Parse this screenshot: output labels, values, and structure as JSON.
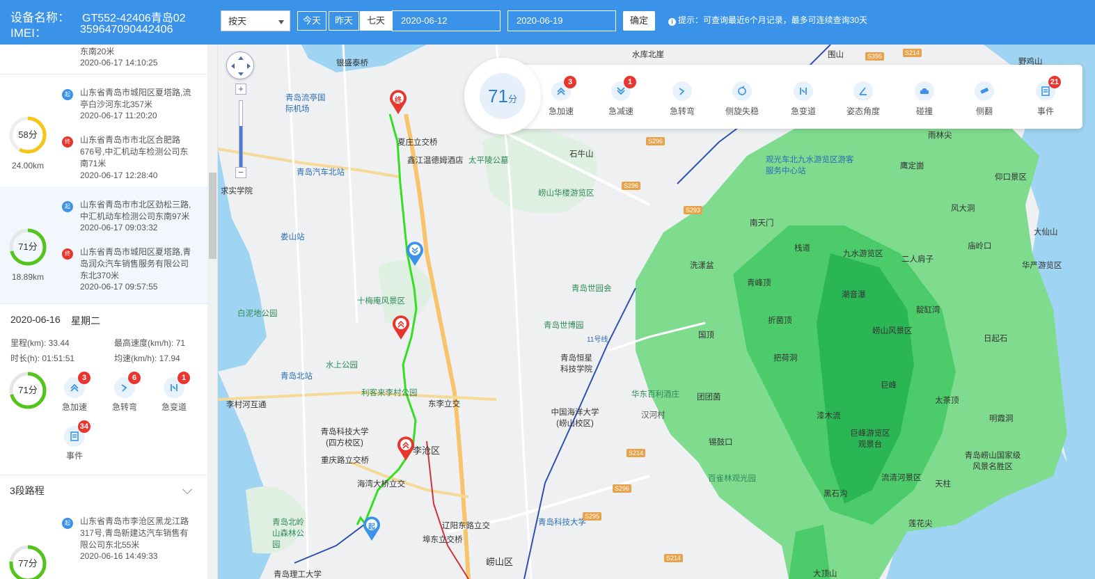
{
  "header": {
    "device_label": "设备名称：",
    "device_name": "GT552-42406青岛02",
    "imei_label": "IMEI：",
    "imei": "359647090442406",
    "mode_select": "按天",
    "btn_today": "今天",
    "btn_yesterday": "昨天",
    "btn_week": "七天",
    "date_start": "2020-06-12",
    "date_end": "2020-06-19",
    "btn_ok": "确定",
    "tip": "提示：可查询最近6个月记录，最多可连续查询30天"
  },
  "trips_top": [
    {
      "partial_addr": "东南20米",
      "partial_time": "2020-06-17 14:10:25"
    },
    {
      "score": "58分",
      "score_value": 58,
      "distance": "24.00km",
      "start_mark": "起",
      "start_addr": "山东省青岛市城阳区夏塔路,流亭白沙河东北357米",
      "start_time": "2020-06-17 11:20:20",
      "end_mark": "终",
      "end_addr": "山东省青岛市市北区合肥路676号,中汇机动车检测公司东南71米",
      "end_time": "2020-06-17 12:28:40"
    },
    {
      "score": "71分",
      "score_value": 71,
      "distance": "18.89km",
      "start_mark": "起",
      "start_addr": "山东省青岛市市北区劲松三路,中汇机动车检测公司东南97米",
      "start_time": "2020-06-17 09:03:32",
      "end_mark": "终",
      "end_addr": "山东省青岛市城阳区夏塔路,青岛润众汽车销售服务有限公司东北370米",
      "end_time": "2020-06-17 09:57:55"
    }
  ],
  "day_summary": {
    "date": "2020-06-16",
    "weekday": "星期二",
    "mileage": "里程(km): 33.44",
    "max_speed": "最高速度(km/h): 71",
    "duration": "时长(h): 01:51:51",
    "avg_speed": "均速(km/h): 17.94",
    "score": "71分",
    "score_value": 71,
    "events": [
      {
        "label": "急加速",
        "count": "3"
      },
      {
        "label": "急转弯",
        "count": "6"
      },
      {
        "label": "急变道",
        "count": "1"
      },
      {
        "label": "事件",
        "count": "34"
      }
    ]
  },
  "segments": {
    "title": "3段路程",
    "first": {
      "score": "77分",
      "score_value": 77,
      "start_mark": "起",
      "start_addr": "山东省青岛市李沧区黑龙江路317号,青岛新建达汽车销售有限公司东北55米",
      "start_time": "2020-06-16 14:49:33"
    }
  },
  "map": {
    "zoom_in": "+",
    "zoom_out": "−",
    "start_pin": "起",
    "end_pin": "终",
    "labels": {
      "l1": "银盛泰桥",
      "l2": "青岛流亭国际机场",
      "l3": "夏庄立交桥",
      "l4": "鑫江温德姆酒店",
      "l5": "太平陵公墓",
      "l6": "石牛山",
      "l7": "崂山华楼游览区",
      "l8": "青岛汽车北站",
      "l9": "娄山站",
      "l10": "十梅庵风景区",
      "l11": "白泥地公园",
      "l12": "青岛世园会",
      "l13": "青岛世博园",
      "l14": "水上公园",
      "l15": "青岛北站",
      "l16": "李村河互通",
      "l17": "利客来李村公园",
      "l18": "东李立交",
      "l19": "青岛科技大学(四方校区)",
      "l20": "重庆路立交桥",
      "l21": "海湾大桥立交",
      "l22": "青岛北岭山森林公园",
      "l23": "辽阳东路立交",
      "l24": "埠东立交桥",
      "l25": "崂山区",
      "l26": "青岛理工大学",
      "l27": "青岛恒星科技学院",
      "l28": "华东百利酒庄",
      "l29": "中国海洋大学(崂山校区)",
      "l30": "汉河村",
      "l31": "青岛科技大学",
      "l32": "水库北崖",
      "l33": "观光车北九水游览区游客服务中心站",
      "l34": "南天门",
      "l35": "洗漾盆",
      "l36": "青峰顶",
      "l37": "栈道",
      "l38": "九水游览区",
      "l39": "潮音瀑",
      "l40": "二人肩子",
      "l41": "靛缸湾",
      "l42": "庙岭口",
      "l43": "华严游览区",
      "l44": "折菌顶",
      "l45": "崂山风景区",
      "l46": "日起石",
      "l47": "国顶",
      "l48": "把荷洞",
      "l49": "巨峰",
      "l50": "团团菌",
      "l51": "漆木流",
      "l52": "太茶顶",
      "l53": "明霞洞",
      "l54": "锡鼓口",
      "l55": "巨峰游览区观景台",
      "l56": "百雀林观光园",
      "l57": "流清河景区",
      "l58": "天柱",
      "l59": "黑石沟",
      "l60": "青岛崂山国家级风景名胜区",
      "l61": "莲花尖",
      "l62": "大顶山",
      "l63": "雨林尖",
      "l64": "鹰定崮",
      "l65": "仰口景区",
      "l66": "风大洞",
      "l67": "大仙山",
      "l68": "野鸡山",
      "l69": "围山",
      "l70": "11号线",
      "l71": "李沧区",
      "l72": "求实学院"
    },
    "road_tags": [
      "S296",
      "S296",
      "S293",
      "S395",
      "S214",
      "S214",
      "S214",
      "S296",
      "S295"
    ]
  },
  "score_card": {
    "score": "71",
    "unit": "分",
    "events": [
      {
        "label": "急加速",
        "count": "3",
        "icon": "accel-icon"
      },
      {
        "label": "急减速",
        "count": "1",
        "icon": "decel-icon"
      },
      {
        "label": "急转弯",
        "count": "",
        "icon": "turn-icon"
      },
      {
        "label": "侧旋失稳",
        "count": "",
        "icon": "spin-icon"
      },
      {
        "label": "急变道",
        "count": "",
        "icon": "lane-change-icon"
      },
      {
        "label": "姿态角度",
        "count": "",
        "icon": "angle-icon"
      },
      {
        "label": "碰撞",
        "count": "",
        "icon": "collision-icon"
      },
      {
        "label": "侧翻",
        "count": "",
        "icon": "rollover-icon"
      },
      {
        "label": "事件",
        "count": "21",
        "icon": "event-icon"
      }
    ]
  },
  "colors": {
    "header": "#3a93e8",
    "accent": "#3a93e8",
    "badge": "#e8352e",
    "route": "#33e01f",
    "score_good": "#52c41a",
    "score_mid": "#f5c518"
  }
}
